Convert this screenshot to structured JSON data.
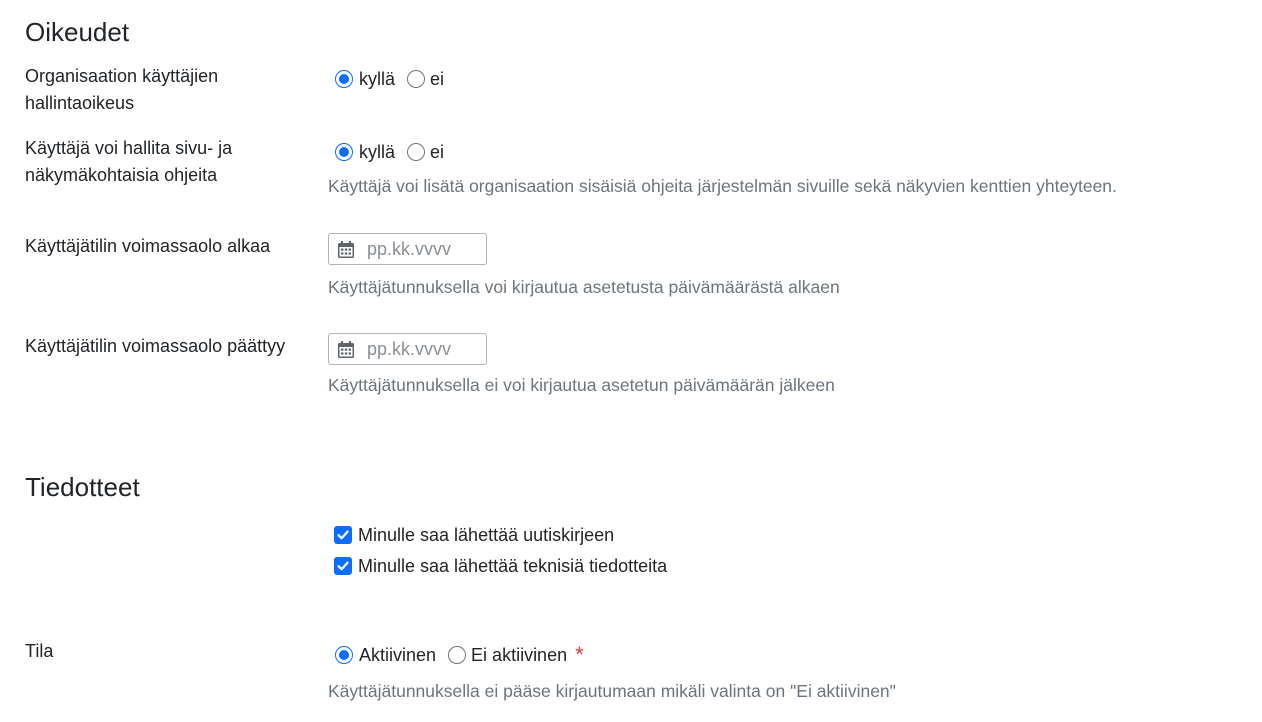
{
  "rights": {
    "heading": "Oikeudet",
    "org_admin": {
      "label": "Organisaation käyttäjien hallintaoikeus",
      "yes": "kyllä",
      "no": "ei",
      "selected": "yes"
    },
    "page_help": {
      "label": "Käyttäjä voi hallita sivu- ja näkymäkohtaisia ohjeita",
      "yes": "kyllä",
      "no": "ei",
      "selected": "yes",
      "help": "Käyttäjä voi lisätä organisaation sisäisiä ohjeita järjestelmän sivuille sekä näkyvien kenttien yhteyteen."
    },
    "valid_from": {
      "label": "Käyttäjätilin voimassaolo alkaa",
      "placeholder": "pp.kk.vvvv",
      "help": "Käyttäjätunnuksella voi kirjautua asetetusta päivämäärästä alkaen"
    },
    "valid_to": {
      "label": "Käyttäjätilin voimassaolo päättyy",
      "placeholder": "pp.kk.vvvv",
      "help": "Käyttäjätunnuksella ei voi kirjautua asetetun päivämäärän jälkeen"
    }
  },
  "bulletins": {
    "heading": "Tiedotteet",
    "newsletter": {
      "label": "Minulle saa lähettää uutiskirjeen",
      "checked": true
    },
    "technical": {
      "label": "Minulle saa lähettää teknisiä tiedotteita",
      "checked": true
    }
  },
  "status": {
    "label": "Tila",
    "active": "Aktiivinen",
    "inactive": "Ei aktiivinen",
    "selected": "active",
    "required_mark": "*",
    "help": "Käyttäjätunnuksella ei pääse kirjautumaan mikäli valinta on \"Ei aktiivinen\""
  },
  "colors": {
    "accent": "#0d6efd",
    "help_text": "#6c757d",
    "required": "#dc3545"
  }
}
